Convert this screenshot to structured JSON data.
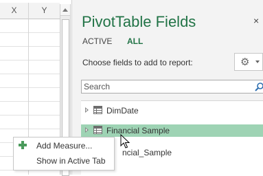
{
  "sheet": {
    "columns": [
      "X",
      "Y"
    ]
  },
  "pivot": {
    "title": "PivotTable Fields",
    "close_glyph": "×",
    "tabs": [
      {
        "label": "ACTIVE"
      },
      {
        "label": "ALL"
      }
    ],
    "choose_label": "Choose fields to add to report:",
    "search": {
      "placeholder": "Search",
      "value": ""
    },
    "fields": [
      {
        "label": "DimDate"
      },
      {
        "label": "Financial Sample"
      },
      {
        "label": "ncial_Sample"
      }
    ],
    "accent": "#217346",
    "highlight": "#9ed3b4"
  },
  "context_menu": {
    "items": [
      {
        "label": "Add Measure..."
      },
      {
        "label": "Show in Active Tab"
      }
    ]
  },
  "icons": [
    "gear-icon",
    "search-icon",
    "table-icon",
    "expand-triangle-icon",
    "add-measure-icon",
    "mouse-cursor-icon"
  ]
}
